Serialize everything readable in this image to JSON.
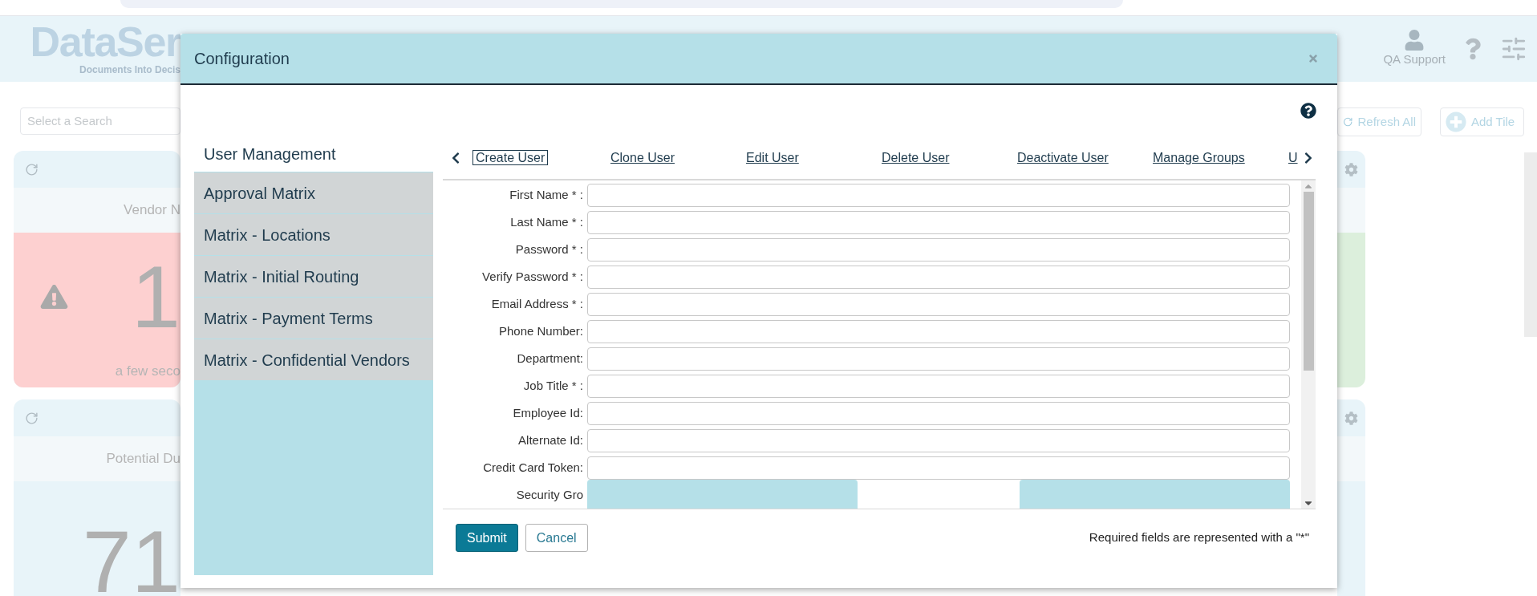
{
  "header": {
    "logo": "DataSer",
    "tagline": "Documents Into Decis",
    "user": "QA Support"
  },
  "search": {
    "placeholder": "Select a Search"
  },
  "toolbar": {
    "buttons": [
      "Refresh All",
      "Add Tile"
    ]
  },
  "tiles_left": [
    {
      "title": "Vendor N",
      "value": "1",
      "time": "a few seco",
      "alert": true,
      "color": "#fdd0d0"
    },
    {
      "title": "Potential Du",
      "value": "71",
      "alert": false,
      "color": "#e8f4f9"
    }
  ],
  "tiles_right": [
    {
      "color": "#dcefdc"
    },
    {
      "color": "#e8f4f9"
    }
  ],
  "modal": {
    "title": "Configuration",
    "sidebar": [
      {
        "label": "User Management",
        "selected": true
      },
      {
        "label": "Approval Matrix",
        "selected": false
      },
      {
        "label": "Matrix - Locations",
        "selected": false
      },
      {
        "label": "Matrix - Initial Routing",
        "selected": false
      },
      {
        "label": "Matrix - Payment Terms",
        "selected": false
      },
      {
        "label": "Matrix - Confidential Vendors",
        "selected": false
      }
    ],
    "tabs": [
      {
        "label": "Create User",
        "selected": true
      },
      {
        "label": "Clone User",
        "selected": false
      },
      {
        "label": "Edit User",
        "selected": false
      },
      {
        "label": "Delete User",
        "selected": false
      },
      {
        "label": "Deactivate User",
        "selected": false
      },
      {
        "label": "Manage Groups",
        "selected": false
      },
      {
        "label": "U",
        "selected": false
      }
    ],
    "fields": [
      {
        "label": "First Name * :"
      },
      {
        "label": "Last Name * :"
      },
      {
        "label": "Password * :"
      },
      {
        "label": "Verify Password * :"
      },
      {
        "label": "Email Address * :"
      },
      {
        "label": "Phone Number:"
      },
      {
        "label": "Department:"
      },
      {
        "label": "Job Title * :"
      },
      {
        "label": "Employee Id:"
      },
      {
        "label": "Alternate Id:"
      },
      {
        "label": "Credit Card Token:"
      },
      {
        "label": "Security Gro"
      }
    ],
    "buttons": [
      {
        "label": "Submit",
        "kind": "primary"
      },
      {
        "label": "Cancel",
        "kind": "secondary"
      }
    ],
    "note": "Required fields are represented with a \"*\""
  }
}
